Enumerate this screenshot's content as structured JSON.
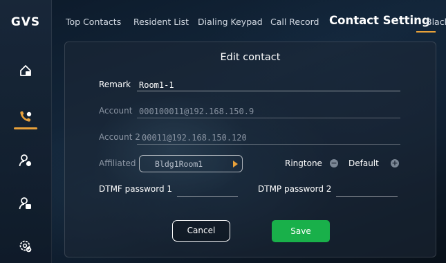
{
  "app": {
    "logo_text": "GVS"
  },
  "sidebar": {
    "items": [
      {
        "icon": "home-lock-icon",
        "active": false
      },
      {
        "icon": "phone-icon",
        "active": true
      },
      {
        "icon": "person-settings-icon",
        "active": false
      },
      {
        "icon": "person-record-icon",
        "active": false
      },
      {
        "icon": "gear-check-icon",
        "active": false
      }
    ]
  },
  "nav": {
    "tabs": [
      {
        "label": "Top Contacts",
        "active": false
      },
      {
        "label": "Resident List",
        "active": false
      },
      {
        "label": "Dialing Keypad",
        "active": false
      },
      {
        "label": "Call Record",
        "active": false
      },
      {
        "label": "Contact Setting",
        "active": true
      },
      {
        "label": "Black",
        "active": false
      }
    ]
  },
  "dialog": {
    "title": "Edit contact",
    "fields": {
      "remark": {
        "label": "Remark",
        "value": "Room1-1"
      },
      "account": {
        "label": "Account",
        "value": "000100011@192.168.150.9"
      },
      "account2": {
        "label": "Account 2",
        "value": "00011@192.168.150.120"
      },
      "affiliated": {
        "label": "Affiliated",
        "value": "Bldg1Room1"
      },
      "ringtone": {
        "label": "Ringtone",
        "value": "Default",
        "minus": "−",
        "plus": "+"
      },
      "dtmf1": {
        "label": "DTMF password 1",
        "value": ""
      },
      "dtmf2": {
        "label": "DTMP password 2",
        "value": ""
      }
    },
    "buttons": {
      "cancel": "Cancel",
      "save": "Save"
    }
  },
  "colors": {
    "accent": "#e8a13a",
    "save": "#19b04a"
  }
}
